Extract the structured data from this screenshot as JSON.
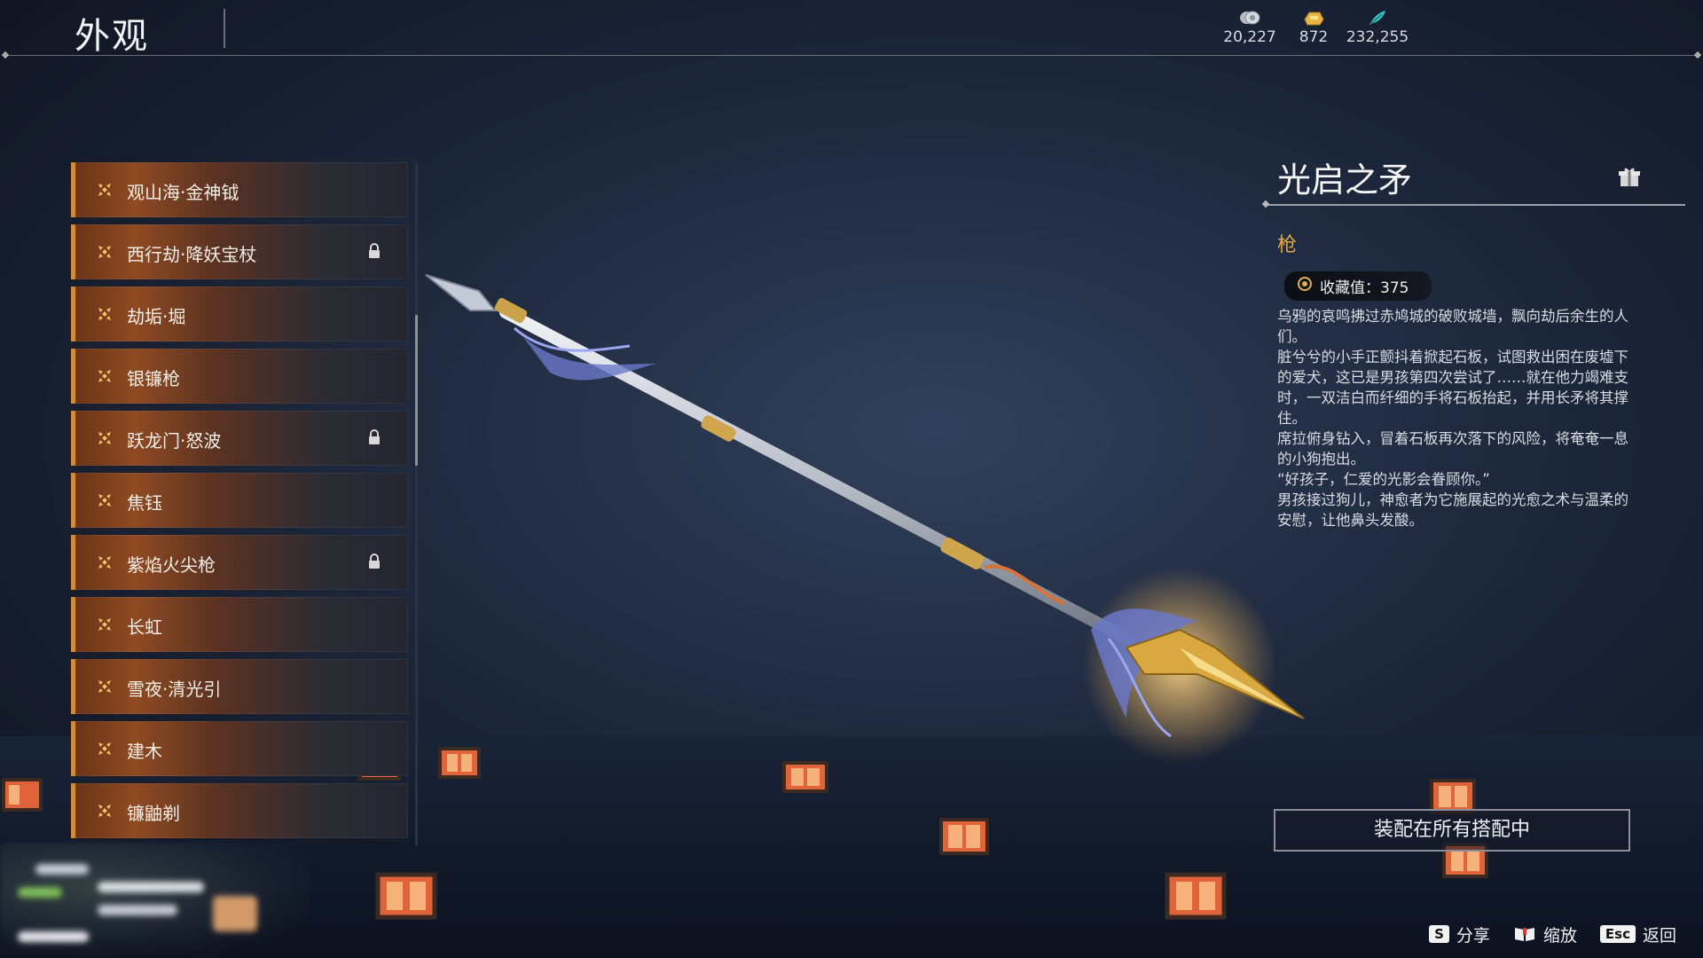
{
  "header": {
    "title": "外观",
    "currencies": [
      {
        "icon": "coin-icon",
        "value": "20,227"
      },
      {
        "icon": "gold-ingot-icon",
        "value": "872"
      },
      {
        "icon": "feather-icon",
        "value": "232,255"
      }
    ]
  },
  "list": {
    "items": [
      {
        "label": "观山海·金神钺",
        "locked": false
      },
      {
        "label": "西行劫·降妖宝杖",
        "locked": true
      },
      {
        "label": "劫垢·堀",
        "locked": false
      },
      {
        "label": "银镰枪",
        "locked": false
      },
      {
        "label": "跃龙门·怒波",
        "locked": true
      },
      {
        "label": "焦钰",
        "locked": false
      },
      {
        "label": "紫焰火尖枪",
        "locked": true
      },
      {
        "label": "长虹",
        "locked": false
      },
      {
        "label": "雪夜·清光引",
        "locked": false
      },
      {
        "label": "建木",
        "locked": false
      },
      {
        "label": "镰鼬剃",
        "locked": false
      }
    ]
  },
  "detail": {
    "name": "光启之矛",
    "type": "枪",
    "collect_label": "收藏值：375",
    "description": [
      "乌鸦的哀鸣拂过赤鸠城的破败城墙，飘向劫后余生的人们。",
      "脏兮兮的小手正颤抖着掀起石板，试图救出困在废墟下的爱犬，这已是男孩第四次尝试了……就在他力竭难支时，一双洁白而纤细的手将石板抬起，并用长矛将其撑住。",
      "席拉俯身钻入，冒着石板再次落下的风险，将奄奄一息的小狗抱出。",
      "“好孩子，仁爱的光影会眷顾你。”",
      "男孩接过狗儿，神愈者为它施展起的光愈之术与温柔的安慰，让他鼻头发酸。"
    ],
    "equip_button": "装配在所有搭配中"
  },
  "hints": [
    {
      "key": "S",
      "label": "分享"
    },
    {
      "key_icon": "book-icon",
      "label": "缩放"
    },
    {
      "key": "Esc",
      "label": "返回"
    }
  ],
  "colors": {
    "accent_orange": "#d28a3a",
    "type_gold": "#e2a844"
  }
}
